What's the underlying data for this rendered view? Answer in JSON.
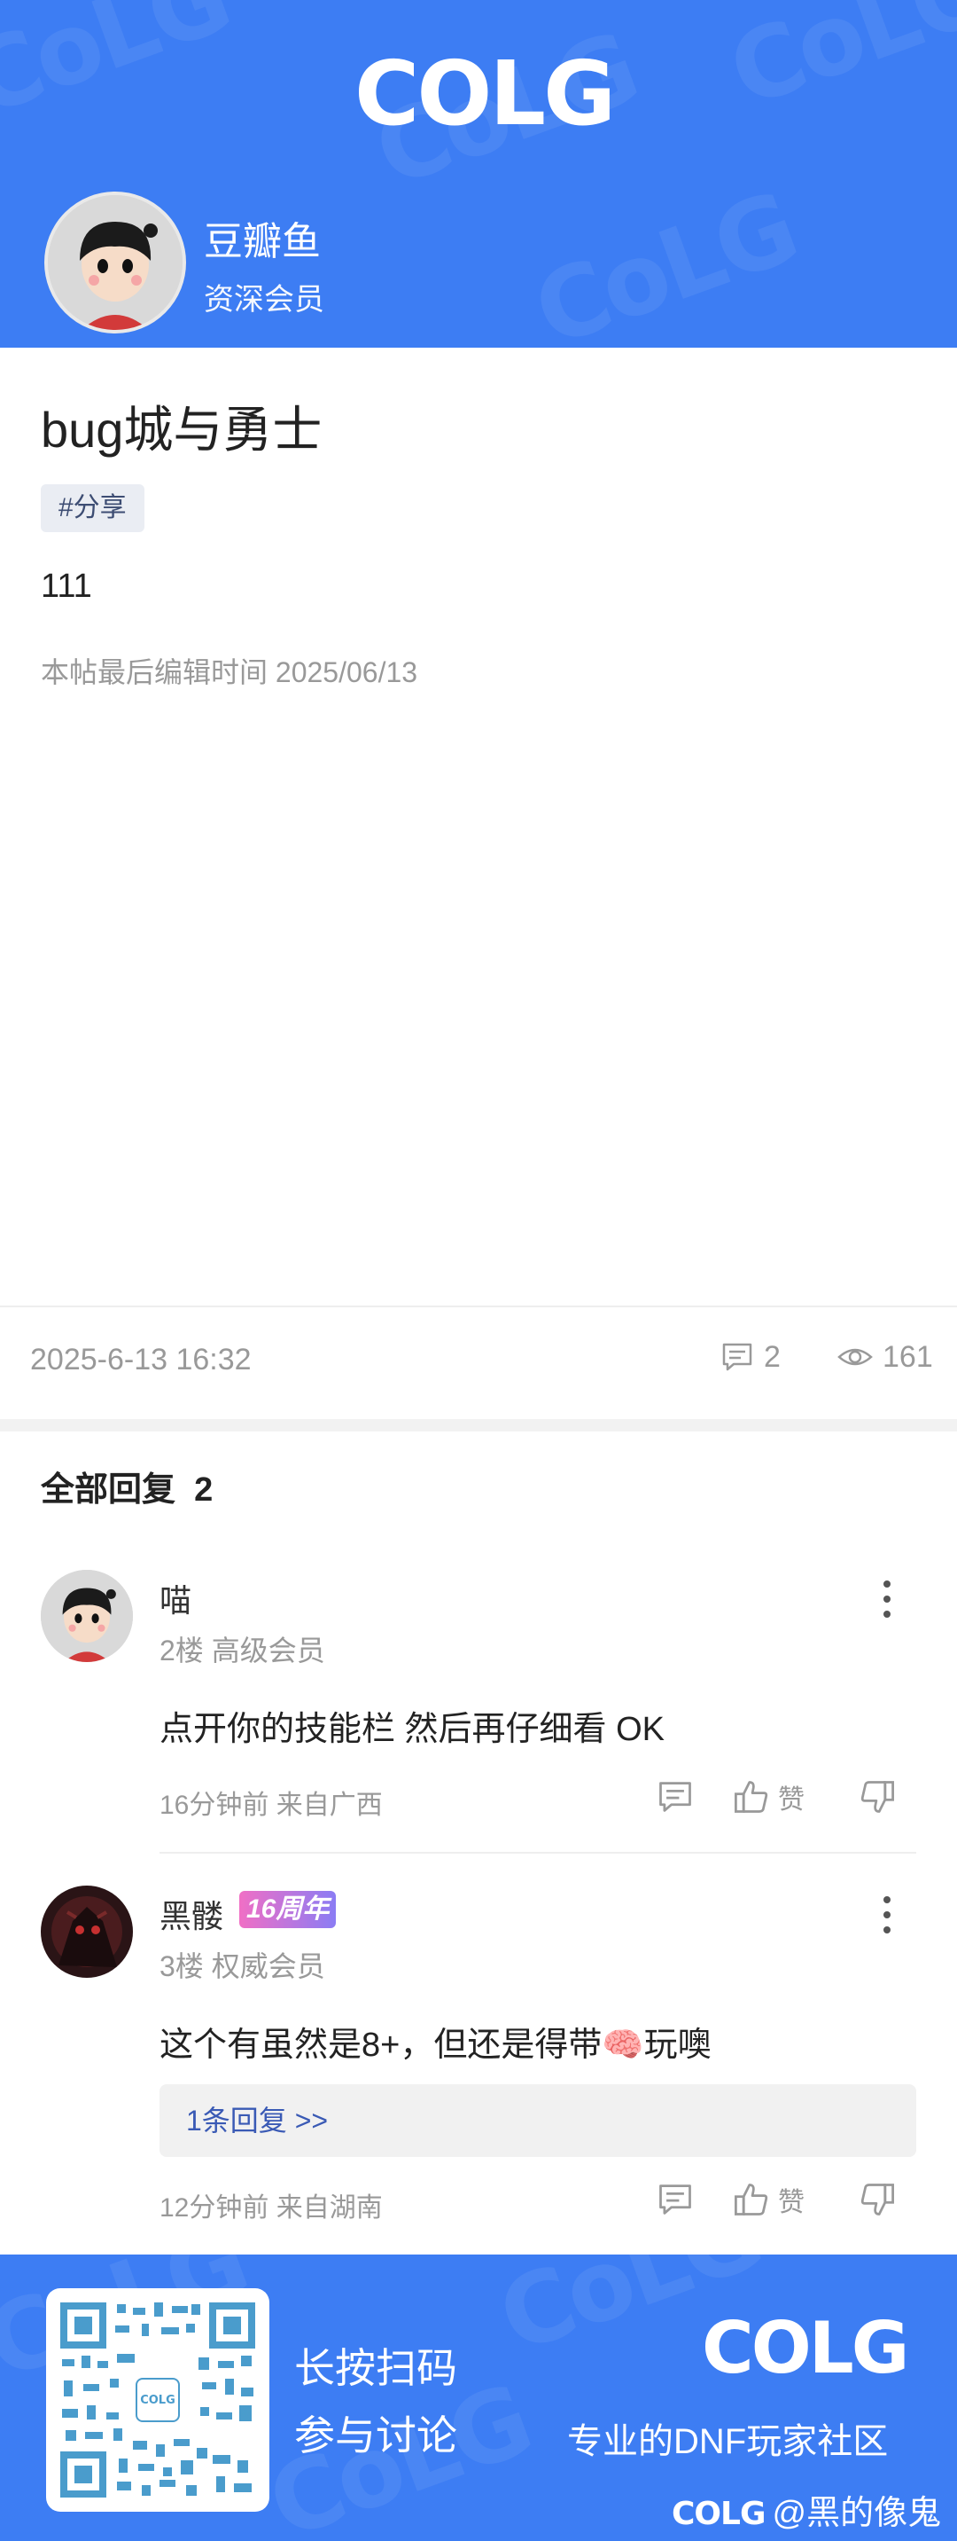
{
  "header": {
    "logo": "COLG",
    "author_name": "豆瓣鱼",
    "author_role": "资深会员"
  },
  "post": {
    "title": "bug城与勇士",
    "tag": "#分享",
    "body": "111",
    "edited": "本帖最后编辑时间 2025/06/13",
    "date": "2025-6-13 16:32",
    "comment_count": "2",
    "view_count": "161"
  },
  "replies": {
    "title": "全部回复",
    "count": "2",
    "items": [
      {
        "name": "喵",
        "floor_level": "2楼 高级会员",
        "text": "点开你的技能栏 然后再仔细看 OK",
        "time_location": "16分钟前 来自广西",
        "like_label": "赞"
      },
      {
        "name": "黑髅",
        "badge": "16周年",
        "floor_level": "3楼 权威会员",
        "text": "这个有虽然是8+，但还是得带🧠玩噢",
        "sub_reply": "1条回复 >>",
        "time_location": "12分钟前 来自湖南",
        "like_label": "赞"
      }
    ]
  },
  "footer": {
    "line1": "长按扫码",
    "line2": "参与讨论",
    "logo": "COLG",
    "slogan": "专业的DNF玩家社区",
    "credit_logo": "COLG",
    "credit": "@黑的像鬼",
    "qr_center": "COLG"
  },
  "colors": {
    "brand_blue": "#3d7df3",
    "tag_bg": "#eaedf3",
    "link_blue": "#3a5ab5"
  }
}
